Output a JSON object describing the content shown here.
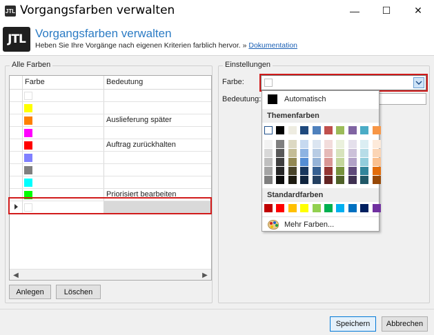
{
  "window": {
    "title": "Vorgangsfarben verwalten",
    "app_icon_text": "JTL",
    "minimize_glyph": "—",
    "maximize_glyph": "☐",
    "close_glyph": "✕"
  },
  "header": {
    "logo_text": "JTL",
    "title": "Vorgangsfarben verwalten",
    "subtitle": "Heben Sie Ihre Vorgänge nach eigenen Kriterien farblich hervor. »",
    "doc_link": "Dokumentation"
  },
  "colors_group": {
    "legend": "Alle Farben",
    "columns": [
      "Farbe",
      "Bedeutung"
    ],
    "rows": [
      {
        "color": "",
        "meaning": ""
      },
      {
        "color": "#ffff00",
        "meaning": ""
      },
      {
        "color": "#ff8000",
        "meaning": "Auslieferung später"
      },
      {
        "color": "#ff00ff",
        "meaning": ""
      },
      {
        "color": "#ff0000",
        "meaning": "Auftrag zurückhalten"
      },
      {
        "color": "#8080ff",
        "meaning": ""
      },
      {
        "color": "#808080",
        "meaning": ""
      },
      {
        "color": "#00ffff",
        "meaning": ""
      },
      {
        "color": "#00ff00",
        "meaning": "Priorisiert bearbeiten"
      },
      {
        "color": "",
        "meaning": ""
      }
    ],
    "add_button": "Anlegen",
    "delete_button": "Löschen"
  },
  "settings_group": {
    "legend": "Einstellungen",
    "color_label": "Farbe:",
    "meaning_label": "Bedeutung:",
    "meaning_value": ""
  },
  "color_picker": {
    "automatic_label": "Automatisch",
    "theme_header": "Themenfarben",
    "standard_header": "Standardfarben",
    "theme_top": [
      "#ffffff",
      "#000000",
      "#eeece1",
      "#1f497d",
      "#4f81bd",
      "#c0504d",
      "#9bbb59",
      "#8064a2",
      "#4bacc6",
      "#f79646"
    ],
    "theme_shades": [
      [
        "#f2f2f2",
        "#7f7f7f",
        "#ddd9c3",
        "#c6d9f0",
        "#dbe5f1",
        "#f2dcdb",
        "#ebf1dd",
        "#e5e0ec",
        "#dbeef3",
        "#fdeada"
      ],
      [
        "#d8d8d8",
        "#595959",
        "#c4bd97",
        "#8db3e2",
        "#b8cce4",
        "#e5b9b7",
        "#d7e3bc",
        "#ccc1d9",
        "#b7dde8",
        "#fbd5b5"
      ],
      [
        "#bfbfbf",
        "#3f3f3f",
        "#938953",
        "#548dd4",
        "#95b3d7",
        "#d99694",
        "#c3d69b",
        "#b2a2c7",
        "#92cddc",
        "#fac08f"
      ],
      [
        "#a5a5a5",
        "#262626",
        "#494429",
        "#17365d",
        "#366092",
        "#953734",
        "#76923c",
        "#5f497a",
        "#31859b",
        "#e36c09"
      ],
      [
        "#7f7f7f",
        "#0c0c0c",
        "#1d1b10",
        "#0f243e",
        "#244061",
        "#632423",
        "#4f6128",
        "#3f3151",
        "#205867",
        "#974806"
      ]
    ],
    "standard": [
      "#c00000",
      "#ff0000",
      "#ffc000",
      "#ffff00",
      "#92d050",
      "#00b050",
      "#00b0f0",
      "#0070c0",
      "#002060",
      "#7030a0"
    ],
    "more_colors": "Mehr Farben..."
  },
  "footer": {
    "save_button": "Speichern",
    "cancel_button": "Abbrechen"
  },
  "highlight_color": "#d11a1a"
}
